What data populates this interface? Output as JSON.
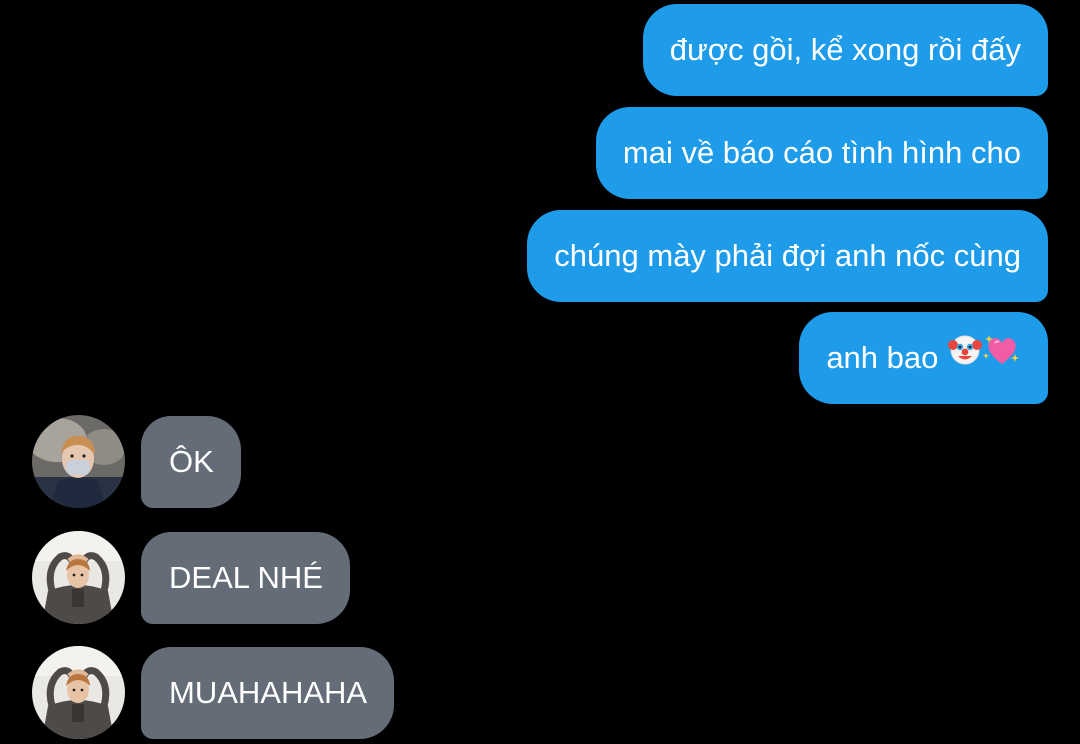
{
  "conversation": {
    "outgoing": [
      {
        "text": "được gồi, kể xong rồi đấy"
      },
      {
        "text": "mai về báo cáo tình hình cho"
      },
      {
        "text": "chúng mày phải đợi anh nốc cùng"
      },
      {
        "text": "anh bao",
        "emojis": [
          "clown-face-emoji",
          "sparkling-heart-emoji"
        ]
      }
    ],
    "incoming": [
      {
        "text": "ÔK",
        "avatar": "avatar-masked-person"
      },
      {
        "text": "DEAL NHÉ",
        "avatar": "avatar-person-heart-pose"
      },
      {
        "text": "MUAHAHAHA",
        "avatar": "avatar-person-heart-pose"
      }
    ]
  },
  "colors": {
    "background": "#000000",
    "outgoing_bubble": "#1e9be9",
    "incoming_bubble": "#636c77",
    "text": "#ffffff"
  }
}
